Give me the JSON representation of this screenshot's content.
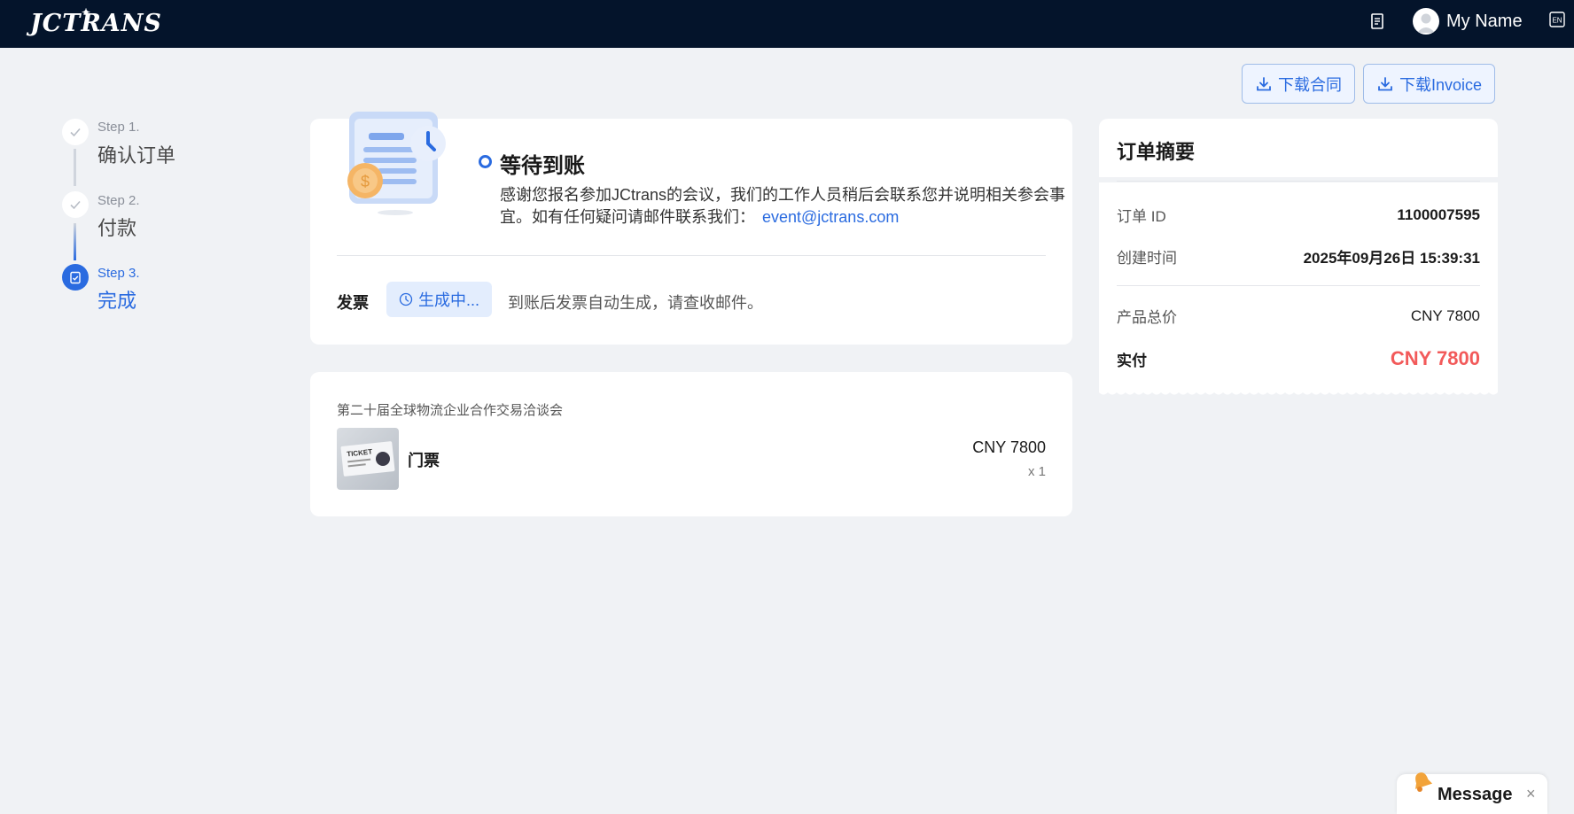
{
  "header": {
    "logo_text": "JCTRANS",
    "username": "My Name",
    "lang_badge": "EN"
  },
  "actions": {
    "download_contract": "下载合同",
    "download_invoice": "下载Invoice"
  },
  "steps": [
    {
      "num": "Step 1.",
      "title": "确认订单",
      "state": "done"
    },
    {
      "num": "Step 2.",
      "title": "付款",
      "state": "done"
    },
    {
      "num": "Step 3.",
      "title": "完成",
      "state": "active"
    }
  ],
  "status": {
    "title": "等待到账",
    "message": "感谢您报名参加JCtrans的会议，我们的工作人员稍后会联系您并说明相关参会事宜。如有任何疑问请邮件联系我们：",
    "email": "event@jctrans.com",
    "invoice_label": "发票",
    "invoice_badge": "生成中...",
    "invoice_note": "到账后发票自动生成，请查收邮件。"
  },
  "order_item": {
    "event_name": "第二十届全球物流企业合作交易洽谈会",
    "ticket_name": "门票",
    "price": "CNY 7800",
    "quantity": "x 1",
    "thumb_text": "TICKET"
  },
  "summary": {
    "title": "订单摘要",
    "order_id_label": "订单 ID",
    "order_id": "1100007595",
    "created_label": "创建时间",
    "created_value": "2025年09月26日 15:39:31",
    "subtotal_label": "产品总价",
    "subtotal_value": "CNY 7800",
    "paid_label": "实付",
    "paid_value": "CNY 7800"
  },
  "message_widget": {
    "label": "Message",
    "close": "×"
  },
  "colors": {
    "header_bg": "#04142b",
    "accent": "#2a6be0",
    "total_price": "#f25a5a",
    "page_bg": "#f0f2f5"
  }
}
